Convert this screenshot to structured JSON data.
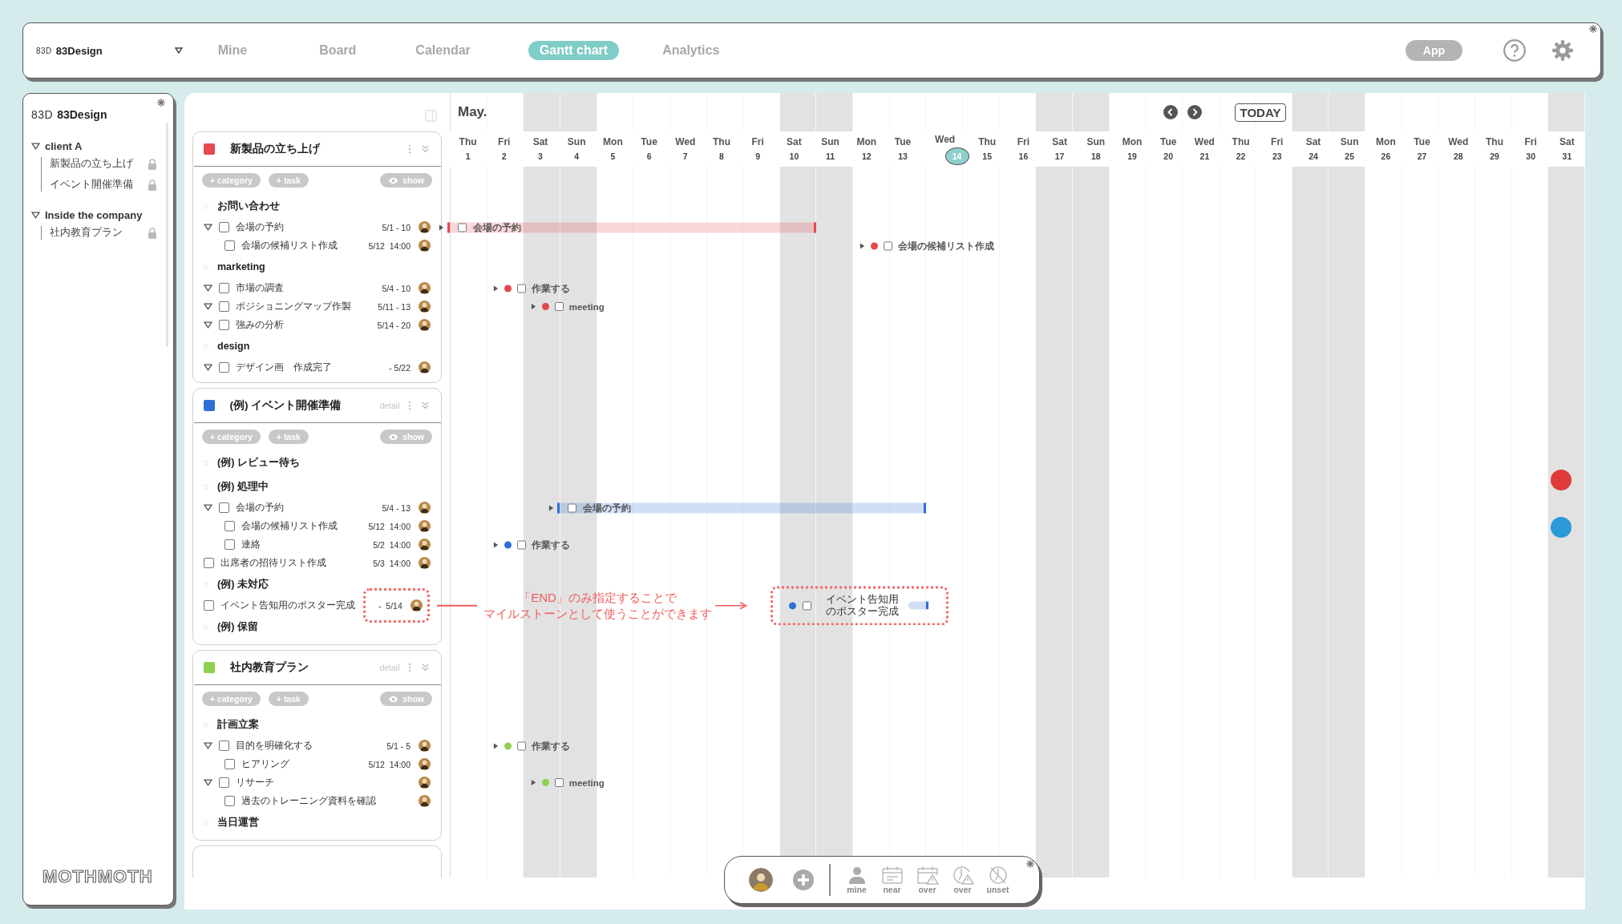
{
  "topbar": {
    "logo_mark": "83D",
    "brand": "83Design",
    "tabs": [
      {
        "label": "Mine",
        "selected": false
      },
      {
        "label": "Board",
        "selected": false
      },
      {
        "label": "Calendar",
        "selected": false
      },
      {
        "label": "Gantt chart",
        "selected": true
      },
      {
        "label": "Analytics",
        "selected": false
      }
    ],
    "app_button": "App"
  },
  "sidebar": {
    "logo_mark": "83D",
    "brand": "83Design",
    "groups": [
      {
        "label": "client A",
        "expanded": true,
        "children": [
          {
            "label": "新製品の立ち上げ",
            "locked": true
          },
          {
            "label": "イベント開催準備",
            "locked": true
          }
        ]
      },
      {
        "label": "Inside the company",
        "expanded": true,
        "children": [
          {
            "label": "社内教育プラン",
            "locked": true
          }
        ]
      }
    ],
    "footer_logo": "MOTHMOTH"
  },
  "gantt": {
    "month": "May.",
    "today_button": "TODAY",
    "days": [
      {
        "name": "Thu",
        "num": "1",
        "weekend": false,
        "selected": false
      },
      {
        "name": "Fri",
        "num": "2",
        "weekend": false,
        "selected": false
      },
      {
        "name": "Sat",
        "num": "3",
        "weekend": true,
        "selected": false
      },
      {
        "name": "Sun",
        "num": "4",
        "weekend": true,
        "selected": false
      },
      {
        "name": "Mon",
        "num": "5",
        "weekend": false,
        "selected": false
      },
      {
        "name": "Tue",
        "num": "6",
        "weekend": false,
        "selected": false
      },
      {
        "name": "Wed",
        "num": "7",
        "weekend": false,
        "selected": false
      },
      {
        "name": "Thu",
        "num": "8",
        "weekend": false,
        "selected": false
      },
      {
        "name": "Fri",
        "num": "9",
        "weekend": false,
        "selected": false
      },
      {
        "name": "Sat",
        "num": "10",
        "weekend": true,
        "selected": false
      },
      {
        "name": "Sun",
        "num": "11",
        "weekend": true,
        "selected": false
      },
      {
        "name": "Mon",
        "num": "12",
        "weekend": false,
        "selected": false
      },
      {
        "name": "Tue",
        "num": "13",
        "weekend": false,
        "selected": false
      },
      {
        "name": "Wed",
        "num": "14",
        "weekend": false,
        "selected": true
      },
      {
        "name": "Thu",
        "num": "15",
        "weekend": false,
        "selected": false
      },
      {
        "name": "Fri",
        "num": "16",
        "weekend": false,
        "selected": false
      },
      {
        "name": "Sat",
        "num": "17",
        "weekend": true,
        "selected": false
      },
      {
        "name": "Sun",
        "num": "18",
        "weekend": true,
        "selected": false
      },
      {
        "name": "Mon",
        "num": "19",
        "weekend": false,
        "selected": false
      },
      {
        "name": "Tue",
        "num": "20",
        "weekend": false,
        "selected": false
      },
      {
        "name": "Wed",
        "num": "21",
        "weekend": false,
        "selected": false
      },
      {
        "name": "Thu",
        "num": "22",
        "weekend": false,
        "selected": false
      },
      {
        "name": "Fri",
        "num": "23",
        "weekend": false,
        "selected": false
      },
      {
        "name": "Sat",
        "num": "24",
        "weekend": true,
        "selected": false
      },
      {
        "name": "Sun",
        "num": "25",
        "weekend": true,
        "selected": false
      },
      {
        "name": "Mon",
        "num": "26",
        "weekend": false,
        "selected": false
      },
      {
        "name": "Tue",
        "num": "27",
        "weekend": false,
        "selected": false
      },
      {
        "name": "Wed",
        "num": "28",
        "weekend": false,
        "selected": false
      },
      {
        "name": "Thu",
        "num": "29",
        "weekend": false,
        "selected": false
      },
      {
        "name": "Fri",
        "num": "30",
        "weekend": false,
        "selected": false
      },
      {
        "name": "Sat",
        "num": "31",
        "weekend": true,
        "selected": false
      }
    ]
  },
  "projects": [
    {
      "title": "新製品の立ち上げ",
      "color": "#e5484d",
      "buttons": [
        {
          "label": "+ category",
          "kind": "add"
        },
        {
          "label": "+ task",
          "kind": "add"
        },
        {
          "label": "show",
          "kind": "eye"
        }
      ],
      "categories": [
        {
          "title": "お問い合わせ",
          "tasks": [
            {
              "label": "会場の予約",
              "date": "5/1 - 10",
              "expanded": true,
              "checked": false,
              "gantt": {
                "kind": "bar",
                "label": "会場の予約"
              },
              "children": [
                {
                  "label": "会場の候補リスト作成",
                  "date": "5/12  14:00",
                  "checked": false,
                  "gantt": {
                    "kind": "point",
                    "label": "会場の候補リスト作成",
                    "level": 0.371
                  }
                }
              ]
            }
          ]
        },
        {
          "title": "marketing",
          "tasks": [
            {
              "label": "市場の調査",
              "date": "5/4 - 10",
              "expanded": true,
              "checked": false,
              "gantt": {
                "kind": "point",
                "label": "作業する",
                "level": 0.048
              }
            },
            {
              "label": "ポジショニングマップ作製",
              "date": "5/11 - 13",
              "expanded": true,
              "checked": false,
              "gantt": {
                "kind": "point",
                "label": "meeting",
                "level": 0.081
              }
            },
            {
              "label": "強みの分析",
              "date": "5/14 - 20",
              "expanded": true,
              "checked": false
            }
          ]
        },
        {
          "title": "design",
          "tasks": [
            {
              "label": "デザイン画　作成完了",
              "date": "- 5/22",
              "expanded": true,
              "checked": false
            }
          ]
        }
      ]
    },
    {
      "title": "(例) イベント開催準備",
      "color": "#2f6fd6",
      "detail": "detail",
      "buttons": [
        {
          "label": "+ category",
          "kind": "add"
        },
        {
          "label": "+ task",
          "kind": "add"
        },
        {
          "label": "show",
          "kind": "eye"
        }
      ],
      "categories": [
        {
          "title": "(例) レビュー待ち"
        },
        {
          "title": "(例) 処理中",
          "tasks": [
            {
              "label": "会場の予約",
              "date": "5/4 - 13",
              "expanded": true,
              "checked": false,
              "gantt": {
                "kind": "bar",
                "label": "会場の予約"
              },
              "children": [
                {
                  "label": "会場の候補リスト作成",
                  "date": "5/12  14:00",
                  "checked": false
                },
                {
                  "label": "連絡",
                  "date": "5/2  14:00",
                  "checked": false,
                  "gantt": {
                    "kind": "point",
                    "label": "作業する",
                    "level": 0.048
                  }
                }
              ]
            },
            {
              "label": "出席者の招待リスト作成",
              "date": "5/3  14:00",
              "checked": false
            }
          ]
        },
        {
          "title": "(例) 未対応",
          "tasks": [
            {
              "label": "イベント告知用のポスター完成",
              "date": "-  5/14",
              "checked": false,
              "callout": true,
              "gantt": {
                "kind": "milestone",
                "label": "イベント告知用のポスター完成"
              }
            }
          ]
        },
        {
          "title": "(例) 保留"
        }
      ]
    },
    {
      "title": "社内教育プラン",
      "color": "#8fd14f",
      "detail": "detail",
      "buttons": [
        {
          "label": "+ category",
          "kind": "add"
        },
        {
          "label": "+ task",
          "kind": "add"
        },
        {
          "label": "show",
          "kind": "eye"
        }
      ],
      "categories": [
        {
          "title": "計画立案",
          "tasks": [
            {
              "label": "目的を明確化する",
              "date": "5/1 - 5",
              "expanded": true,
              "checked": false,
              "gantt": {
                "kind": "point",
                "label": "作業する",
                "level": 0.048
              },
              "children": [
                {
                  "label": "ヒアリング",
                  "date": "5/12  14:00",
                  "checked": false
                }
              ]
            },
            {
              "label": "リサーチ",
              "expanded": true,
              "checked": false,
              "gantt": {
                "kind": "point",
                "label": "meeting",
                "level": 0.081
              },
              "children": [
                {
                  "label": "過去のトレーニング資料を確認",
                  "checked": false
                }
              ]
            }
          ]
        },
        {
          "title": "当日運営"
        }
      ]
    }
  ],
  "callout": {
    "lines": [
      "「END」のみ指定することで",
      "マイルストーンとして使うことができます"
    ]
  },
  "side_markers": [
    {
      "color": "#e03a3a"
    },
    {
      "color": "#2b9ad9"
    }
  ],
  "toolbar": {
    "filters": [
      {
        "kind": "person",
        "label": "mine"
      },
      {
        "kind": "calendar",
        "label": "near"
      },
      {
        "kind": "calendar-alert",
        "label": "over"
      },
      {
        "kind": "clock-alert",
        "label": "over"
      },
      {
        "kind": "clock-off",
        "label": "unset"
      }
    ]
  }
}
